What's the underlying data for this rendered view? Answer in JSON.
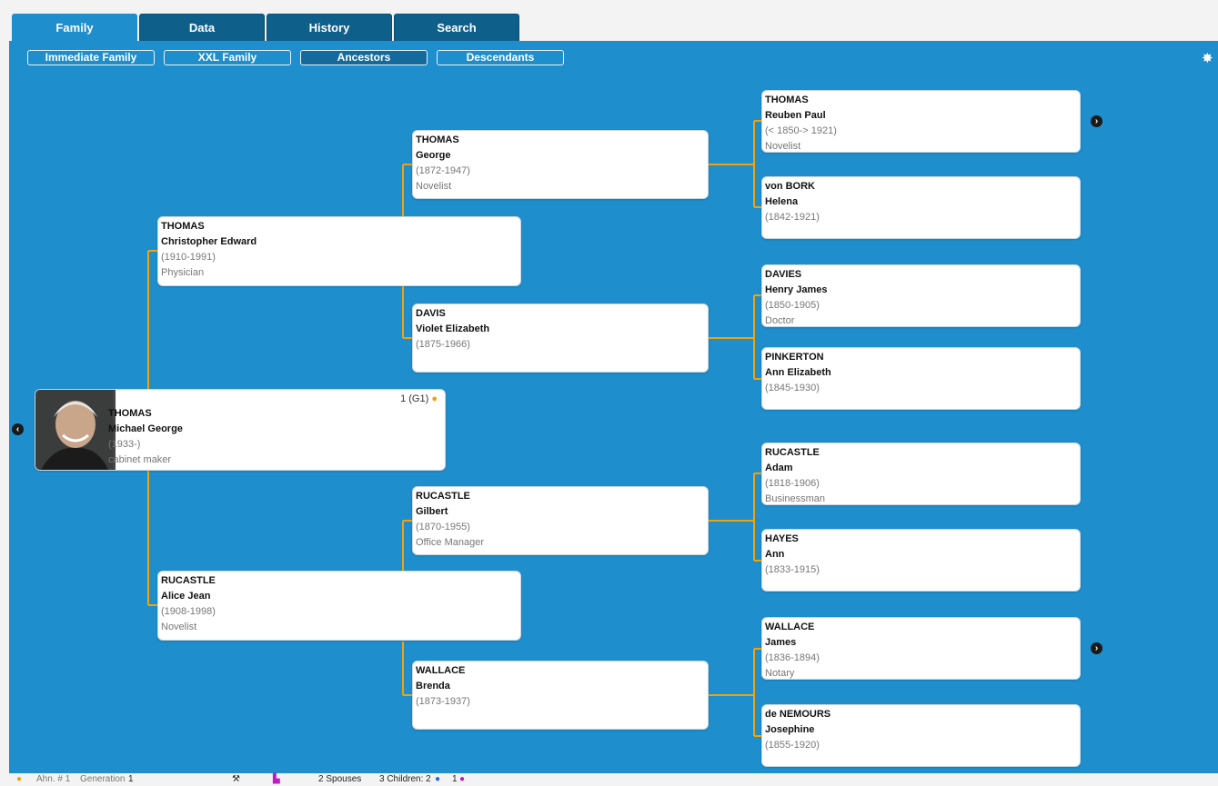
{
  "tabs": [
    {
      "label": "Family",
      "active": true
    },
    {
      "label": "Data",
      "active": false
    },
    {
      "label": "History",
      "active": false
    },
    {
      "label": "Search",
      "active": false
    }
  ],
  "subtabs": [
    {
      "label": "Immediate Family",
      "active": false
    },
    {
      "label": "XXL Family",
      "active": false
    },
    {
      "label": "Ancestors",
      "active": true
    },
    {
      "label": "Descendants",
      "active": false
    }
  ],
  "root": {
    "surname": "THOMAS",
    "given": "Michael George",
    "dates": "(1933-)",
    "occupation": "cabinet maker",
    "rank": "1 (G1)"
  },
  "parents": {
    "father": {
      "surname": "THOMAS",
      "given": "Christopher Edward",
      "dates": "(1910-1991)",
      "occupation": "Physician"
    },
    "mother": {
      "surname": "RUCASTLE",
      "given": "Alice Jean",
      "dates": "(1908-1998)",
      "occupation": "Novelist"
    }
  },
  "grandparents": {
    "ff": {
      "surname": "THOMAS",
      "given": "George",
      "dates": "(1872-1947)",
      "occupation": "Novelist"
    },
    "fm": {
      "surname": "DAVIS",
      "given": "Violet Elizabeth",
      "dates": "(1875-1966)",
      "occupation": ""
    },
    "mf": {
      "surname": "RUCASTLE",
      "given": "Gilbert",
      "dates": "(1870-1955)",
      "occupation": "Office Manager"
    },
    "mm": {
      "surname": "WALLACE",
      "given": "Brenda",
      "dates": "(1873-1937)",
      "occupation": ""
    }
  },
  "great": {
    "fff": {
      "surname": "THOMAS",
      "given": "Reuben Paul",
      "dates": "(< 1850-> 1921)",
      "occupation": "Novelist"
    },
    "ffm": {
      "surname": "von BORK",
      "given": "Helena",
      "dates": "(1842-1921)",
      "occupation": ""
    },
    "fmf": {
      "surname": "DAVIES",
      "given": "Henry James",
      "dates": "(1850-1905)",
      "occupation": "Doctor"
    },
    "fmm": {
      "surname": "PINKERTON",
      "given": "Ann Elizabeth",
      "dates": "(1845-1930)",
      "occupation": ""
    },
    "mff": {
      "surname": "RUCASTLE",
      "given": "Adam",
      "dates": "(1818-1906)",
      "occupation": "Businessman"
    },
    "mfm": {
      "surname": "HAYES",
      "given": "Ann",
      "dates": "(1833-1915)",
      "occupation": ""
    },
    "mmf": {
      "surname": "WALLACE",
      "given": "James",
      "dates": "(1836-1894)",
      "occupation": "Notary"
    },
    "mmm": {
      "surname": "de NEMOURS",
      "given": "Josephine",
      "dates": "(1855-1920)",
      "occupation": ""
    }
  },
  "status": {
    "ahn": "Ahn. # 1",
    "generation_label": "Generation",
    "generation_value": "1",
    "spouses": "2 Spouses",
    "children": "3 Children: 2",
    "children_female": "1"
  },
  "colors": {
    "panel": "#1e8ecd",
    "tab": "#0e5f8a",
    "connector": "#f2a20a"
  },
  "icons": {
    "gear": "gear-icon",
    "nav_left": "chevron-left-icon",
    "nav_right": "chevron-right-icon",
    "person": "person-icon"
  }
}
